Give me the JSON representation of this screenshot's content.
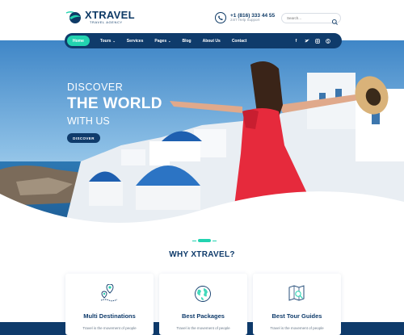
{
  "brand": {
    "name": "XTRAVEL",
    "tagline": "TRAVEL AGENCY",
    "accent_color": "#22d3b0",
    "primary_color": "#0f3b6b"
  },
  "contact": {
    "phone": "+1 (816) 333 44 55",
    "support": "24/7 Help Support"
  },
  "search": {
    "placeholder": "Search..."
  },
  "nav": {
    "items": [
      {
        "label": "Home",
        "active": true
      },
      {
        "label": "Tours",
        "has_dropdown": true
      },
      {
        "label": "Services"
      },
      {
        "label": "Pages",
        "has_dropdown": true
      },
      {
        "label": "Blog"
      },
      {
        "label": "About Us"
      },
      {
        "label": "Contact"
      }
    ],
    "socials": [
      "facebook-icon",
      "twitter-icon",
      "instagram-icon",
      "skype-icon"
    ]
  },
  "hero": {
    "line1": "DISCOVER",
    "line2": "THE WORLD",
    "line3": "WITH US",
    "button": "DISCOVER"
  },
  "why": {
    "title": "WHY XTRAVEL?",
    "cards": [
      {
        "title": "Multi Destinations",
        "desc": "Travel is the movement of people",
        "icon": "map-pin-icon"
      },
      {
        "title": "Best Packages",
        "desc": "Travel is the movement of people",
        "icon": "globe-icon"
      },
      {
        "title": "Best Tour Guides",
        "desc": "Travel is the movement of people",
        "icon": "map-search-icon"
      }
    ]
  }
}
